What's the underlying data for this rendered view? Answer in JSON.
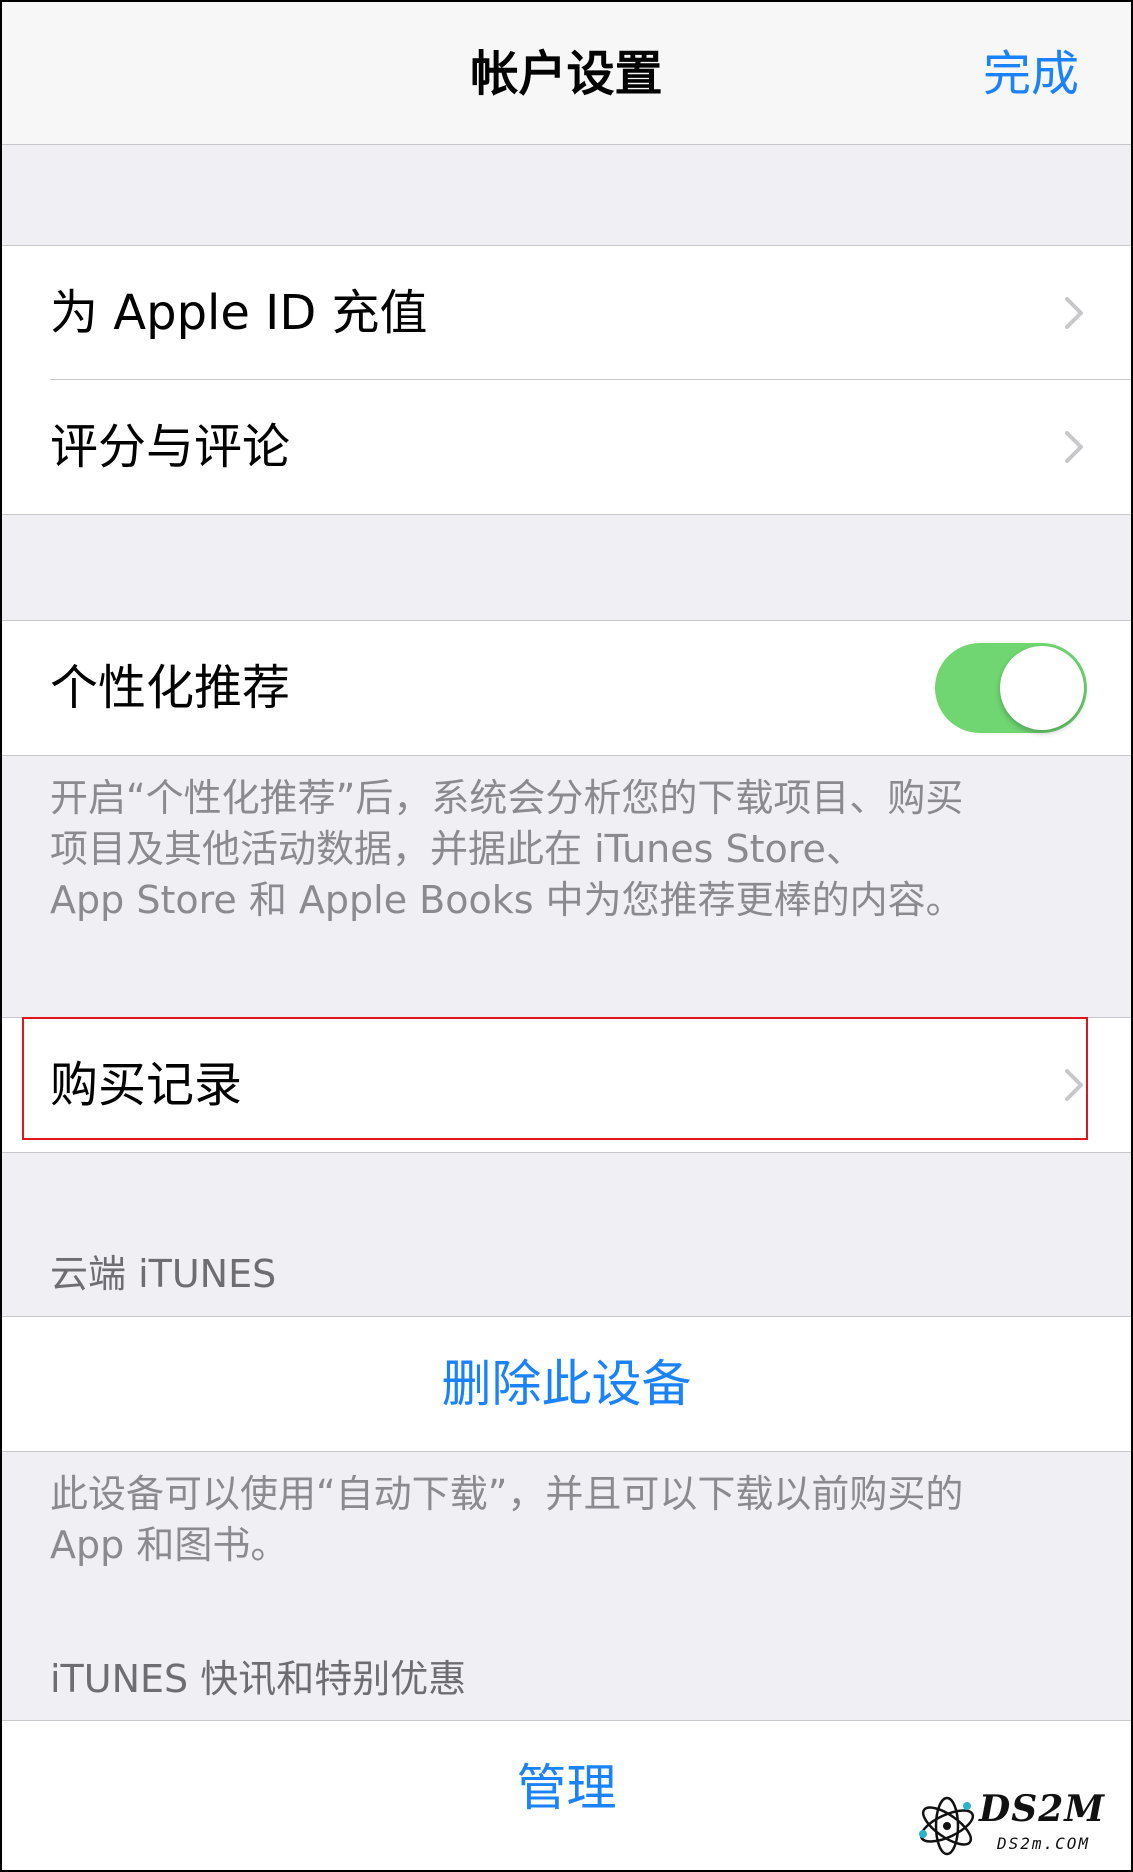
{
  "navbar": {
    "title": "帐户设置",
    "done_label": "完成"
  },
  "group1": {
    "items": [
      {
        "label": "为 Apple ID 充值"
      },
      {
        "label": "评分与评论"
      }
    ]
  },
  "personalization": {
    "label": "个性化推荐",
    "toggle_on": true,
    "toggle_color": "#6fd671",
    "footer_lines": [
      "开启“个性化推荐”后，系统会分析您的下载项目、购买",
      "项目及其他活动数据，并据此在 iTunes Store、",
      "App Store 和 Apple Books 中为您推荐更棒的内容。"
    ]
  },
  "purchase_history": {
    "label": "购买记录",
    "highlight_color": "#e0161b"
  },
  "cloud_itunes": {
    "header": "云端 iTUNES",
    "button_label": "删除此设备",
    "footer_lines": [
      "此设备可以使用“自动下载”，并且可以下载以前购买的",
      "App 和图书。"
    ]
  },
  "newsletters": {
    "header": "iTUNES 快讯和特别优惠",
    "button_label": "管理"
  },
  "watermark": {
    "logo_text": "DS2M",
    "sub_text": "DS2m.COM"
  },
  "colors": {
    "accent": "#1a82fb",
    "background": "#efeff4",
    "separator": "#c8c7cc"
  }
}
